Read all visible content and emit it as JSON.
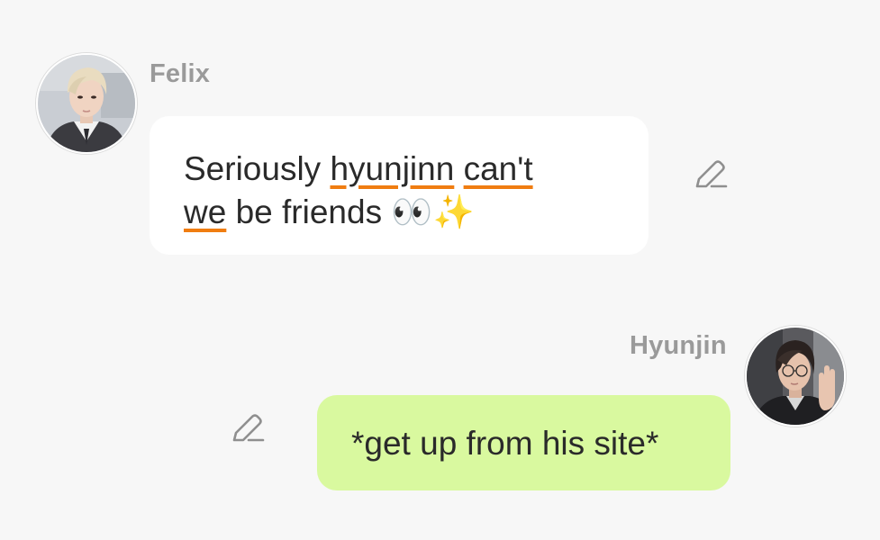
{
  "messages": [
    {
      "sender": "Felix",
      "avatar_icon": "felix-avatar-photo",
      "bubble_color": "#ffffff",
      "text_parts": {
        "w1": "Seriously",
        "w2": "hyunjinn",
        "w3": "can't",
        "w4": "we",
        "w5": "be friends",
        "emoji_eyes": "👀",
        "emoji_sparkles": "✨"
      },
      "misspelled_words": [
        "hyunjinn",
        "can't",
        "we"
      ],
      "edit_icon": "pencil-icon"
    },
    {
      "sender": "Hyunjin",
      "avatar_icon": "hyunjin-avatar-photo",
      "bubble_color": "#d9f99f",
      "text": "*get up from his site*",
      "edit_icon": "pencil-icon"
    }
  ],
  "colors": {
    "background": "#f7f7f7",
    "name_gray": "#9a9a9a",
    "spellcheck_underline": "#f07d11",
    "text": "#2a2a2a"
  }
}
